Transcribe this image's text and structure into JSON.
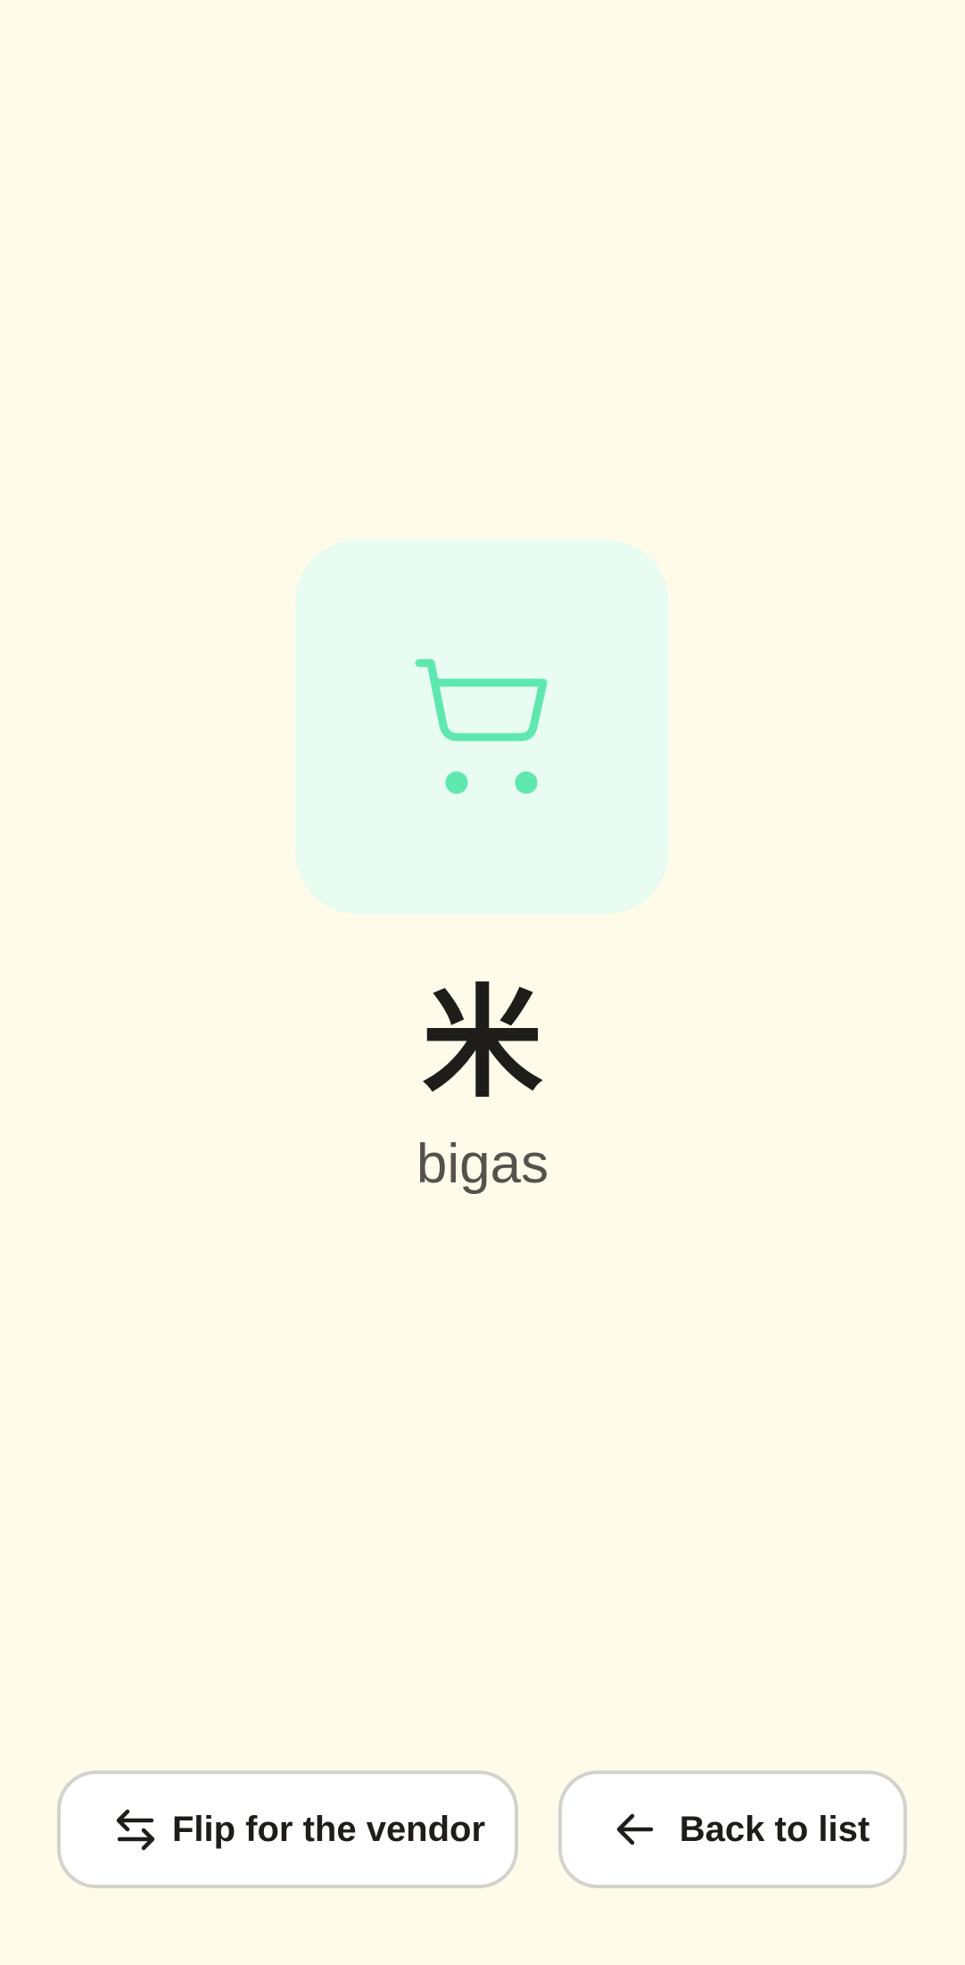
{
  "card": {
    "icon": "shopping-cart-icon",
    "accent_color": "#5ee8b0",
    "tile_color": "#e8fcf1"
  },
  "word": {
    "main": "米",
    "translation": "bigas"
  },
  "actions": {
    "flip_label": "Flip for the vendor",
    "flip_icon": "swap-arrows-icon",
    "back_label": "Back to list",
    "back_icon": "arrow-left-icon"
  },
  "colors": {
    "background": "#fffbea",
    "text": "#1f1d1a",
    "subtext": "#55524c",
    "button_border": "#d4d2cb"
  }
}
